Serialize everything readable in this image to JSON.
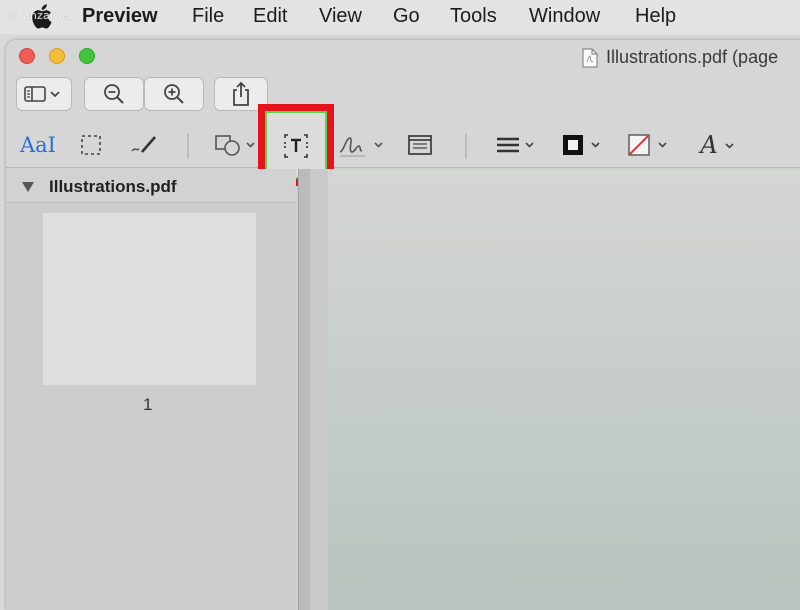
{
  "watermark": "© anzaiweb",
  "menubar": {
    "app_name": "Preview",
    "items": [
      "File",
      "Edit",
      "View",
      "Go",
      "Tools",
      "Window",
      "Help"
    ]
  },
  "window": {
    "title": "Illustrations.pdf (page"
  },
  "toolbar": {
    "icons": [
      "sidebar-toggle-icon",
      "zoom-out-icon",
      "zoom-in-icon",
      "share-icon"
    ]
  },
  "markup": {
    "text_selection_label": "AaI",
    "tools": [
      "text-selection",
      "rectangular-selection",
      "sketch",
      "shapes",
      "text-box",
      "sign",
      "note",
      "shape-style",
      "border-color",
      "fill-color",
      "text-style"
    ],
    "text_style_label": "A"
  },
  "sidebar": {
    "file_name": "Illustrations.pdf",
    "page_number": "1"
  },
  "colors": {
    "highlight_border": "#e3141b",
    "highlight_inner": "#57d64a",
    "accent_blue": "#2a6fd6"
  }
}
